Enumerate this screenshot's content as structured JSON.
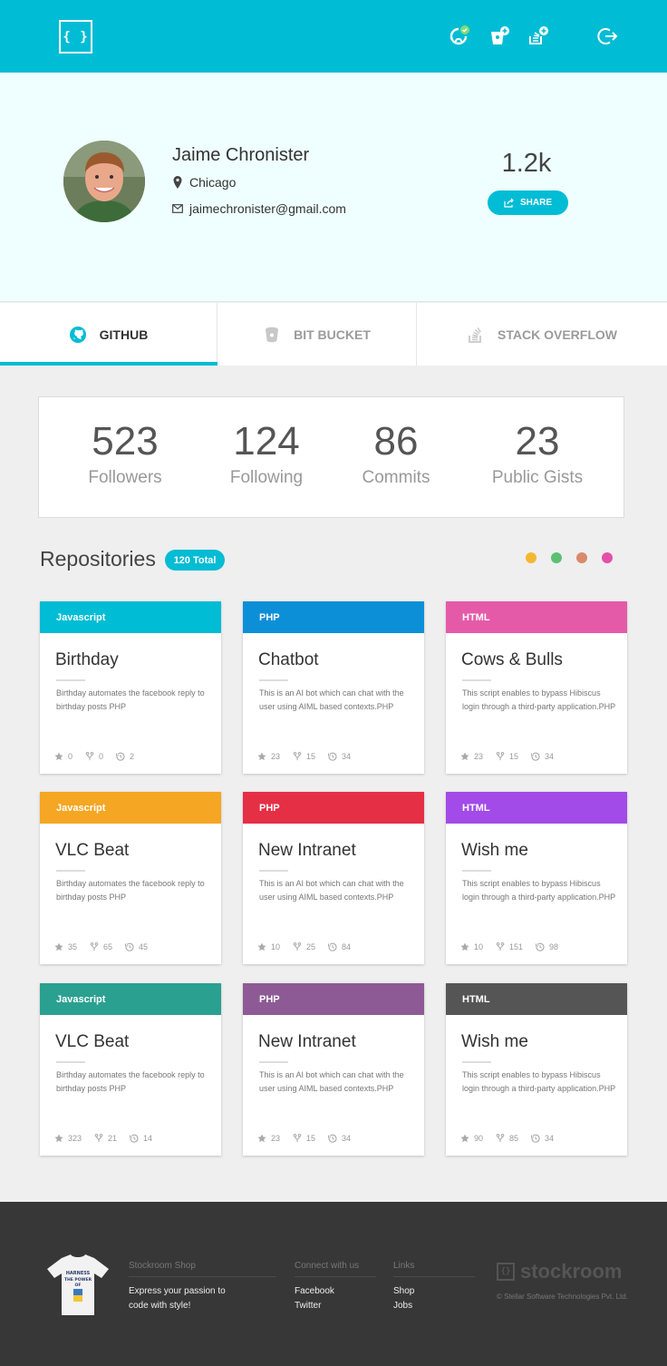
{
  "header": {
    "logo": "{ }",
    "icons": [
      "github-connected-icon",
      "bitbucket-add-icon",
      "stackoverflow-add-icon",
      "logout-icon"
    ]
  },
  "profile": {
    "name": "Jaime Chronister",
    "city": "Chicago",
    "email": "jaimechronister@gmail.com",
    "score": "1.2k",
    "share_label": "SHARE"
  },
  "tabs": [
    {
      "label": "GITHUB",
      "icon": "github-icon"
    },
    {
      "label": "BIT BUCKET",
      "icon": "bitbucket-icon"
    },
    {
      "label": "STACK OVERFLOW",
      "icon": "stackoverflow-icon"
    }
  ],
  "stats": [
    {
      "value": "523",
      "label": "Followers"
    },
    {
      "value": "124",
      "label": "Following"
    },
    {
      "value": "86",
      "label": "Commits"
    },
    {
      "value": "23",
      "label": "Public Gists"
    }
  ],
  "repositories": {
    "title": "Repositories",
    "total": "120 Total",
    "filter_colors": [
      "#f5b731",
      "#5cc072",
      "#d88a6a",
      "#e54fa9"
    ],
    "cards": [
      {
        "lang": "Javascript",
        "color": "#00bcd4",
        "title": "Birthday",
        "desc": "Birthday automates the facebook reply to birthday posts PHP",
        "stars": "0",
        "forks": "0",
        "history": "2"
      },
      {
        "lang": "PHP",
        "color": "#0d8fd8",
        "title": "Chatbot",
        "desc": "This is an AI bot which can chat with the user using AIML based contexts.PHP",
        "stars": "23",
        "forks": "15",
        "history": "34"
      },
      {
        "lang": "HTML",
        "color": "#e55aa8",
        "title": "Cows & Bulls",
        "desc": "This script enables to bypass Hibiscus login through a third-party application.PHP",
        "stars": "23",
        "forks": "15",
        "history": "34"
      },
      {
        "lang": "Javascript",
        "color": "#f5a623",
        "title": "VLC Beat",
        "desc": "Birthday automates the facebook reply to birthday posts PHP",
        "stars": "35",
        "forks": "65",
        "history": "45"
      },
      {
        "lang": "PHP",
        "color": "#e52f45",
        "title": "New Intranet",
        "desc": "This is an AI bot which can chat with the user using AIML based contexts.PHP",
        "stars": "10",
        "forks": "25",
        "history": "84"
      },
      {
        "lang": "HTML",
        "color": "#a24be8",
        "title": "Wish me",
        "desc": "This script enables to bypass Hibiscus login through a third-party application.PHP",
        "stars": "10",
        "forks": "151",
        "history": "98"
      },
      {
        "lang": "Javascript",
        "color": "#2aa090",
        "title": "VLC Beat",
        "desc": "Birthday automates the facebook reply to birthday posts PHP",
        "stars": "323",
        "forks": "21",
        "history": "14"
      },
      {
        "lang": "PHP",
        "color": "#8e5a95",
        "title": "New Intranet",
        "desc": "This is an AI bot which can chat with the user using AIML based contexts.PHP",
        "stars": "23",
        "forks": "15",
        "history": "34"
      },
      {
        "lang": "HTML",
        "color": "#555555",
        "title": "Wish me",
        "desc": "This script enables to bypass Hibiscus login through a third-party application.PHP",
        "stars": "90",
        "forks": "85",
        "history": "34"
      }
    ]
  },
  "footer": {
    "shop_head": "Stockroom Shop",
    "shop_text_1": "Express your passion to",
    "shop_text_2": "code with style!",
    "connect_head": "Connect with us",
    "connect_links": [
      "Facebook",
      "Twitter"
    ],
    "links_head": "Links",
    "links": [
      "Shop",
      "Jobs"
    ],
    "brand": "stockroom",
    "copyright": "© Stellar Software Technologies Pvt. Ltd.",
    "shirt_text": "HARNESS THE POWER OF"
  }
}
